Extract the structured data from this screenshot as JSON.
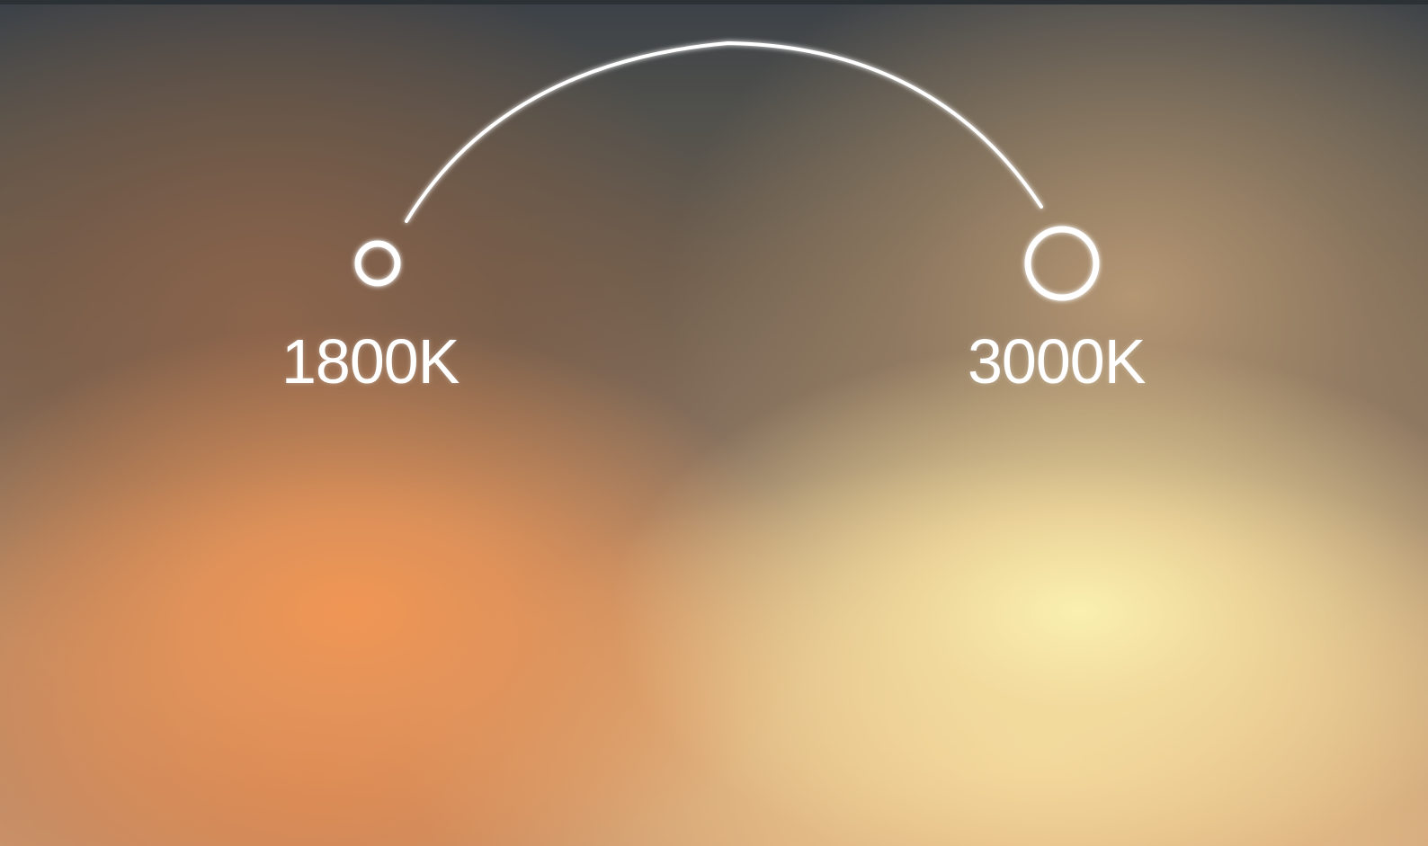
{
  "temperatures": {
    "warm": {
      "label": "1800K",
      "glow_color": "#ef9a58"
    },
    "cool": {
      "label": "3000K",
      "glow_color": "#f6eca8"
    }
  },
  "colors": {
    "top_background": "#3b4147",
    "arc_stroke": "#ffffff"
  }
}
